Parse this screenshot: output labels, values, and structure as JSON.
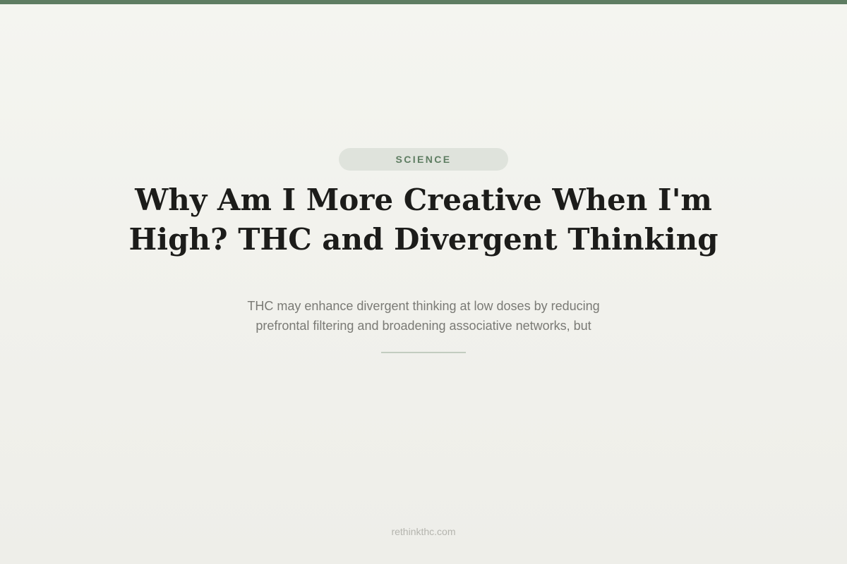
{
  "colors": {
    "accent": "#5e7d62",
    "pill_background": "#dfe3dc",
    "pill_text": "#5e7d62",
    "divider": "#c2ccc0"
  },
  "article": {
    "category": "SCIENCE",
    "title_line1": "Why Am I More Creative When I'm",
    "title_line2": "High? THC and Divergent Thinking",
    "subtitle_line1": "THC may enhance divergent thinking at low doses by reducing",
    "subtitle_line2": "prefrontal filtering and broadening associative networks, but"
  },
  "footer": {
    "site": "rethinkthc.com"
  }
}
